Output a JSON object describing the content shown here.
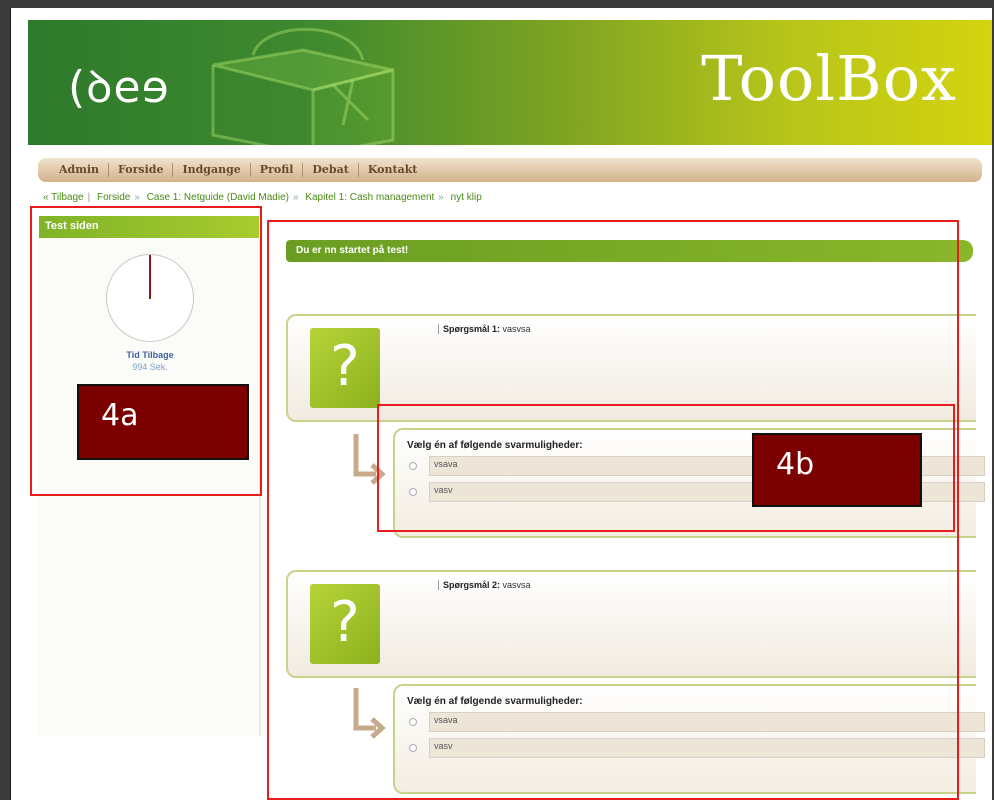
{
  "header": {
    "logo": "(ꝺeɘ",
    "brand": "ToolBox"
  },
  "nav": [
    "Admin",
    "Forside",
    "Indgange",
    "Profil",
    "Debat",
    "Kontakt"
  ],
  "breadcrumb": {
    "back": "« Tilbage",
    "items": [
      "Forside",
      "Case 1: Netguide (David Madie)",
      "Kapitel 1: Cash management",
      "nyt klip"
    ]
  },
  "side": {
    "title": "Test siden",
    "timer_label": "Tid Tilbage",
    "timer_value": "994 Sek."
  },
  "main": {
    "title": "Du er nn startet på   test!",
    "questions": [
      {
        "label": "Spørgsmål 1:",
        "text": "vasvsa",
        "prompt": "Vælg én af følgende svarmuligheder:",
        "options": [
          "vsava",
          "vasv"
        ]
      },
      {
        "label": "Spørgsmål 2:",
        "text": "vasvsa",
        "prompt": "Vælg én af følgende svarmuligheder:",
        "options": [
          "vsava",
          "vasv"
        ]
      }
    ]
  },
  "annotations": {
    "a": "4a",
    "b": "4b"
  },
  "colors": {
    "accent_green": "#80b328",
    "annotation_red": "#e81c1c",
    "label_bg": "#7d0000"
  }
}
